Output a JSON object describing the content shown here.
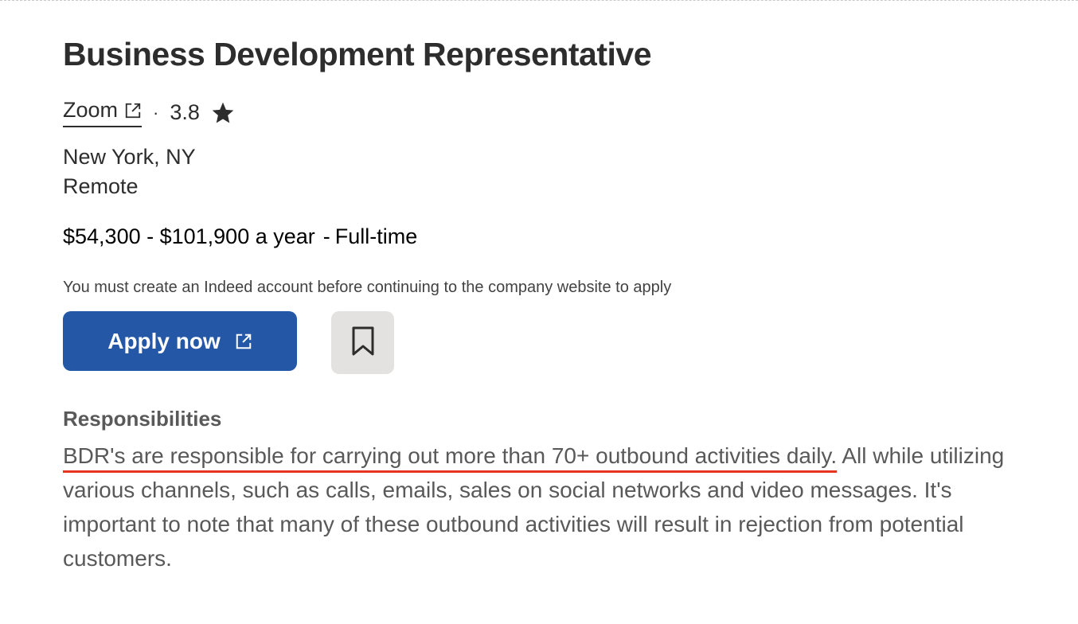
{
  "job": {
    "title": "Business Development Representative",
    "company": "Zoom",
    "rating_separator": "·",
    "rating": "3.8",
    "location": "New York, NY",
    "work_type": "Remote",
    "salary": "$54,300 - $101,900 a year",
    "employment_separator": "-",
    "employment_type": "Full-time"
  },
  "apply": {
    "notice": "You must create an Indeed account before continuing to the company website to apply",
    "button_label": "Apply now"
  },
  "icons": {
    "company_link": "external-link-icon",
    "rating": "star-icon",
    "apply": "external-link-icon",
    "save": "bookmark-icon"
  },
  "description": {
    "heading": "Responsibilities",
    "highlighted_text": "BDR's are responsible for carrying out more than 70+ outbound activities daily.",
    "rest_text": " All while utilizing various channels, such as calls, emails, sales on social networks and video messages. It's important to note that many of these outbound activities will result in rejection from potential customers."
  },
  "colors": {
    "apply_button": "#2557a7",
    "save_button": "#e4e2e0",
    "highlight_underline": "#e8331e",
    "title_text": "#2d2d2d",
    "body_text": "#595959"
  }
}
